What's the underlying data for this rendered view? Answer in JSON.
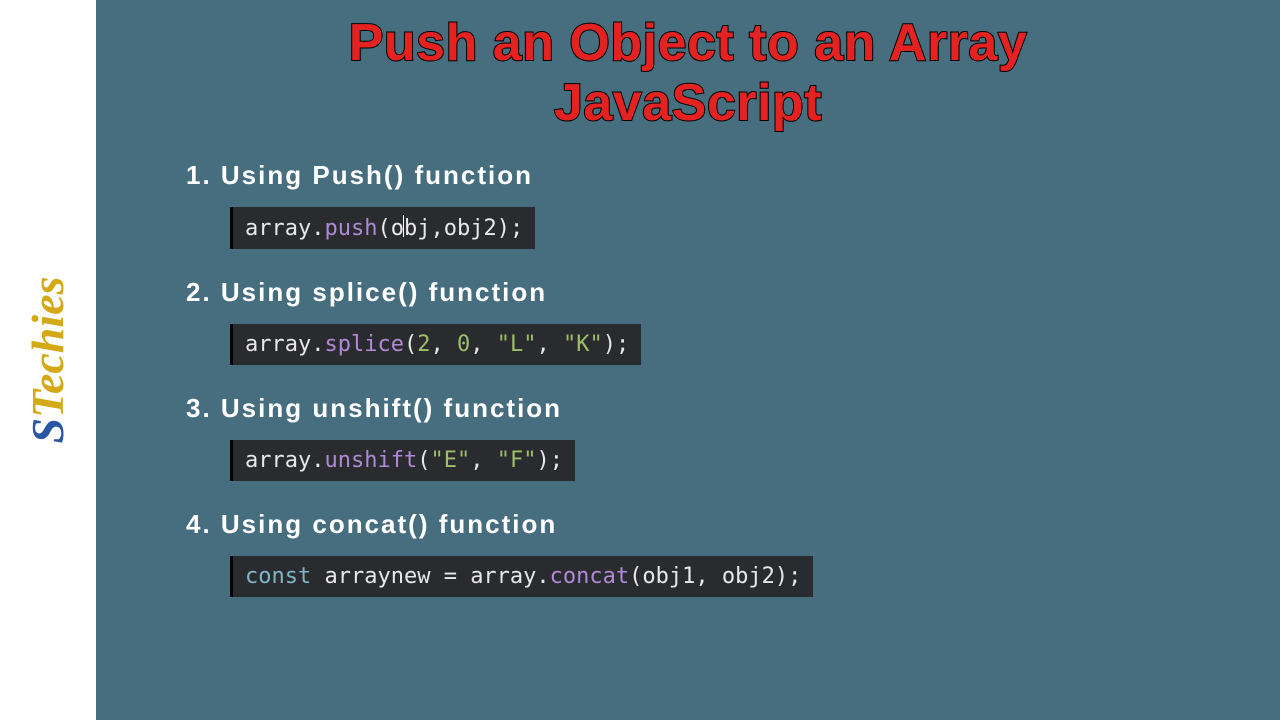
{
  "brand": {
    "first": "S",
    "rest": "Techies"
  },
  "title": {
    "line1": "Push an Object to an Array",
    "line2": "JavaScript"
  },
  "items": [
    {
      "heading": "1. Using Push() function",
      "code": {
        "obj": "array",
        "method": "push",
        "arg1": "o",
        "arg1b": "bj",
        "arg2": "obj2",
        "punct": {
          "open": "(",
          "comma": ",",
          "close": ");"
        }
      }
    },
    {
      "heading": "2. Using splice() function",
      "code": {
        "obj": "array",
        "method": "splice",
        "n1": "2",
        "n2": "0",
        "s1": "\"L\"",
        "s2": "\"K\"",
        "punct": {
          "open": "(",
          "comma": ", ",
          "close": ");"
        }
      }
    },
    {
      "heading": "3. Using unshift() function",
      "code": {
        "obj": "array",
        "method": "unshift",
        "s1": "\"E\"",
        "s2": "\"F\"",
        "punct": {
          "open": "(",
          "comma": ", ",
          "close": ");"
        }
      }
    },
    {
      "heading": "4. Using concat() function",
      "code": {
        "kw": "const",
        "lhs": " arraynew ",
        "eq": "= ",
        "obj": "array",
        "method": "concat",
        "arg1": "obj1",
        "arg2": "obj2",
        "punct": {
          "open": "(",
          "comma": ", ",
          "close": ");"
        }
      }
    }
  ]
}
